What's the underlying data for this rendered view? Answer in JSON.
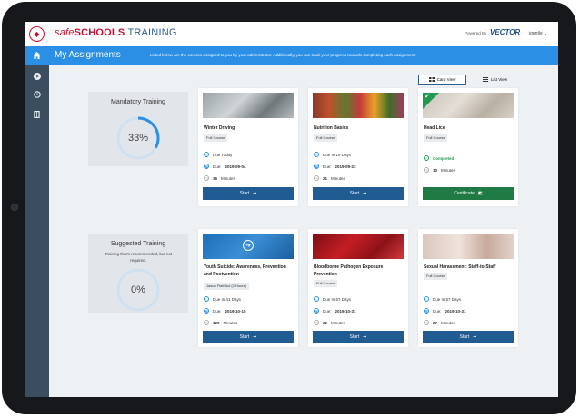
{
  "brand": {
    "safe": "safe",
    "schools": "SCHOOLS",
    "training": " TRAINING"
  },
  "topbar": {
    "powered_by": "Powered By",
    "vendor": "VECTOR",
    "user": "jgentle"
  },
  "banner": {
    "title": "My Assignments",
    "description": "Listed below are the courses assigned to you by your administrator. Additionally, you can track your progress towards completing each assignment."
  },
  "view_toggle": {
    "card_label": "Card View",
    "list_label": "List View",
    "selected": "Card View"
  },
  "mandatory": {
    "label": "Mandatory Training",
    "percent_text": "33%",
    "progress": 0.33
  },
  "suggested": {
    "label": "Suggested Training",
    "subtitle": "Training that's recommended, but not required.",
    "percent_text": "0%",
    "progress": 0
  },
  "mandatory_cards": [
    {
      "title": "Winter Driving",
      "badge": "Full Course",
      "due_relative": "Due Today",
      "due_label": "Due:",
      "due_date": "2019-09-04",
      "minutes": "15",
      "minutes_label": "Minutes",
      "button": "Start"
    },
    {
      "title": "Nutrition Basics",
      "badge": "Full Course",
      "due_relative": "Due In 19 Days",
      "due_label": "Due:",
      "due_date": "2019-09-23",
      "minutes": "21",
      "minutes_label": "Minutes",
      "button": "Start"
    },
    {
      "title": "Head Lice",
      "badge": "Full Course",
      "status": "Completed",
      "minutes": "10",
      "minutes_label": "Minutes",
      "button": "Certificate"
    }
  ],
  "suggested_cards": [
    {
      "title": "Youth Suicide: Awareness, Prevention and Postvention",
      "badge": "Jason Flatt Act (2 Hours)",
      "due_relative": "Due In 41 Days",
      "due_label": "Due:",
      "due_date": "2019-10-15",
      "minutes": "120",
      "minutes_label": "Minutes",
      "button": "Start"
    },
    {
      "title": "Bloodborne Pathogen Exposure Prevention",
      "badge": "Full Course",
      "due_relative": "Due In 57 Days",
      "due_label": "Due:",
      "due_date": "2019-10-31",
      "minutes": "22",
      "minutes_label": "Minutes",
      "button": "Start"
    },
    {
      "title": "Sexual Harassment: Staff-to-Staff",
      "badge": "Full Course",
      "due_relative": "Due In 57 Days",
      "due_label": "Due:",
      "due_date": "2019-10-31",
      "minutes": "27",
      "minutes_label": "Minutes",
      "button": "Start"
    }
  ],
  "colors": {
    "accent": "#2b8fe6",
    "button": "#205b92",
    "success": "#1f7a43",
    "brand_red": "#c8102e"
  },
  "icons": {
    "rail": [
      "home-icon",
      "play-icon",
      "history-icon",
      "library-icon"
    ]
  }
}
